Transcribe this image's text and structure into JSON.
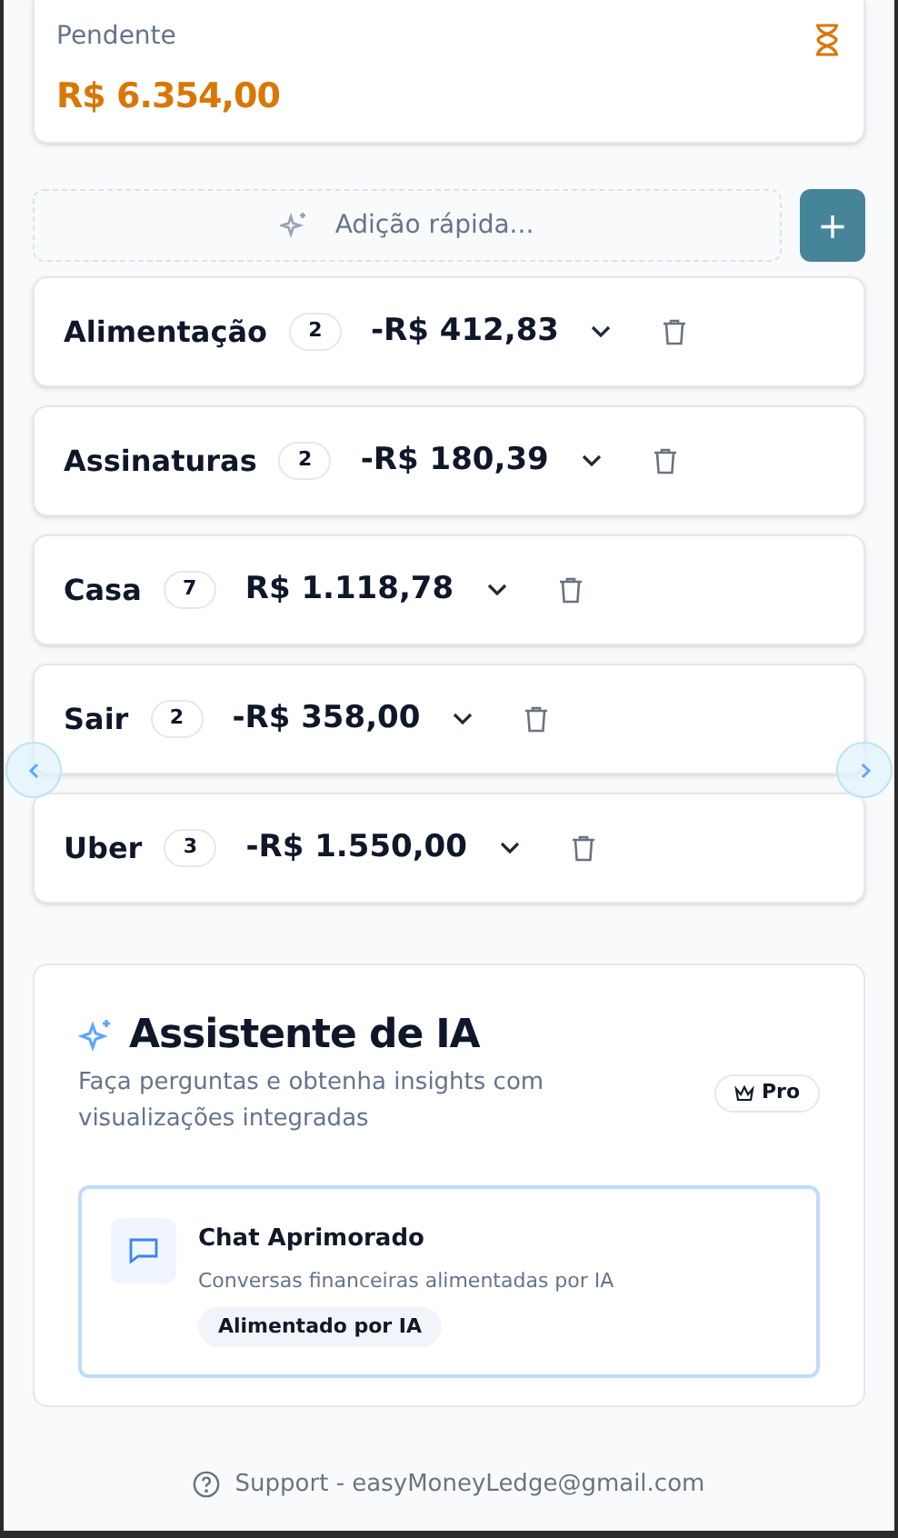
{
  "pending": {
    "label": "Pendente",
    "amount": "R$ 6.354,00"
  },
  "quick_add": {
    "placeholder": "Adição rápida...",
    "add_button": "+"
  },
  "categories": [
    {
      "name": "Alimentação",
      "count": "2",
      "amount": "-R$ 412,83"
    },
    {
      "name": "Assinaturas",
      "count": "2",
      "amount": "-R$ 180,39"
    },
    {
      "name": "Casa",
      "count": "7",
      "amount": "R$ 1.118,78"
    },
    {
      "name": "Sair",
      "count": "2",
      "amount": "-R$ 358,00"
    },
    {
      "name": "Uber",
      "count": "3",
      "amount": "-R$ 1.550,00"
    }
  ],
  "ai_assistant": {
    "title": "Assistente de IA",
    "subtitle": "Faça perguntas e obtenha insights com visualizações integradas",
    "badge": "Pro",
    "feature": {
      "title": "Chat Aprimorado",
      "description": "Conversas financeiras alimentadas por IA",
      "tag": "Alimentado por IA"
    }
  },
  "footer": "Support - easyMoneyLedge@gmail.com"
}
